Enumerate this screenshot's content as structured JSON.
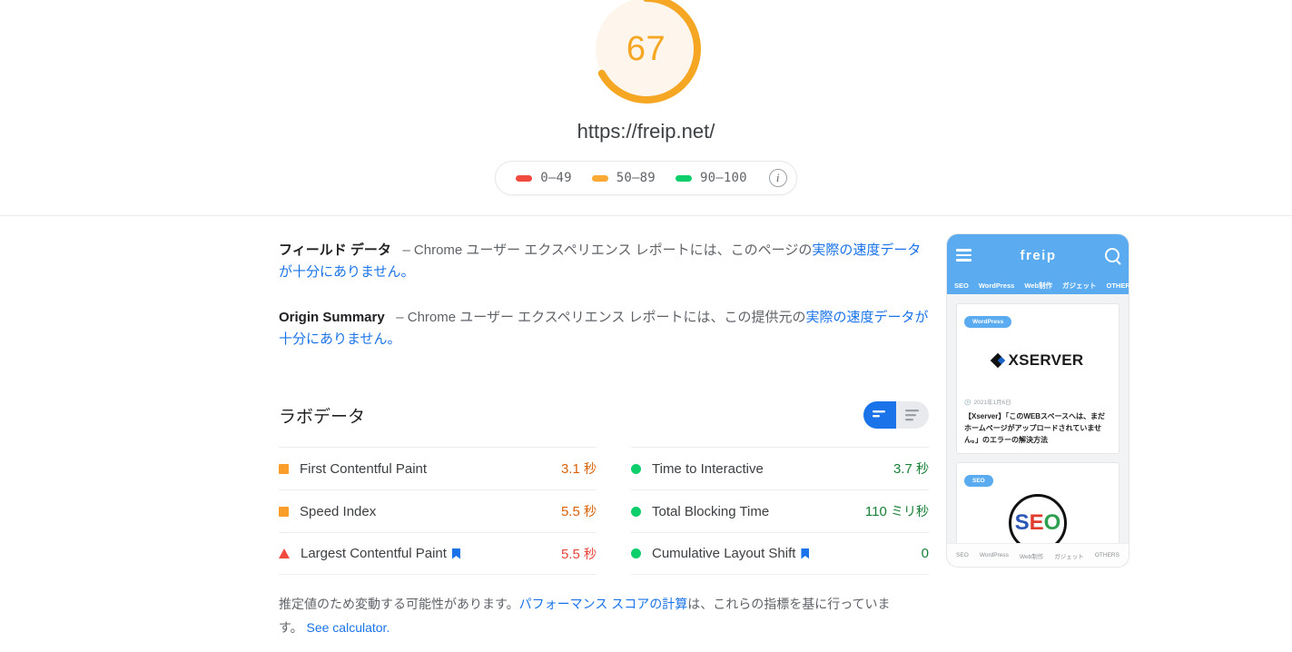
{
  "score": {
    "value": "67",
    "value_number": 67,
    "url": "https://freip.net/",
    "gauge_color": "#f5a623",
    "gauge_track_color": "#fef5e7"
  },
  "legend": {
    "items": [
      {
        "label": "0–49",
        "color": "#f04b3e",
        "name": "legend-range-poor"
      },
      {
        "label": "50–89",
        "color": "#faa935",
        "name": "legend-range-average"
      },
      {
        "label": "90–100",
        "color": "#0cce6b",
        "name": "legend-range-good"
      }
    ],
    "info_glyph": "i"
  },
  "field_data": {
    "title": "フィールド データ",
    "dash": "–",
    "text_before_link": "Chrome ユーザー エクスペリエンス レポートには、このページの",
    "link_text": "実際の速度データが十分にありません。"
  },
  "origin_summary": {
    "title": "Origin Summary",
    "dash": "–",
    "text_before_link": "Chrome ユーザー エクスペリエンス レポートには、この提供元の",
    "link_text": "実際の速度データが十分にありません。"
  },
  "lab_data": {
    "title": "ラボデータ",
    "view_toggle": {
      "active": "list-compact-view",
      "buttons": [
        {
          "name": "toggle-compact-view",
          "state": "active"
        },
        {
          "name": "toggle-detail-view",
          "state": "inactive"
        }
      ]
    },
    "metrics_left": [
      {
        "label": "First Contentful Paint",
        "value": "3.1",
        "unit": "秒",
        "status": "average",
        "icon": "square",
        "value_color_class": "v-orange",
        "bookmark": false
      },
      {
        "label": "Speed Index",
        "value": "5.5",
        "unit": "秒",
        "status": "average",
        "icon": "square",
        "value_color_class": "v-orange",
        "bookmark": false
      },
      {
        "label": "Largest Contentful Paint",
        "value": "5.5",
        "unit": "秒",
        "status": "poor",
        "icon": "triangle",
        "value_color_class": "v-red",
        "bookmark": true
      }
    ],
    "metrics_right": [
      {
        "label": "Time to Interactive",
        "value": "3.7",
        "unit": "秒",
        "status": "good",
        "icon": "circle",
        "value_color_class": "v-green",
        "bookmark": false
      },
      {
        "label": "Total Blocking Time",
        "value": "110",
        "unit": "ミリ秒",
        "status": "good",
        "icon": "circle",
        "value_color_class": "v-green",
        "bookmark": false
      },
      {
        "label": "Cumulative Layout Shift",
        "value": "0",
        "unit": "",
        "status": "good",
        "icon": "circle",
        "value_color_class": "v-green",
        "bookmark": true
      }
    ],
    "footnote": {
      "part1": "推定値のため変動する可能性があります。",
      "link1": "パフォーマンス スコアの計算",
      "part2": "は、これらの指標を基に行っています。",
      "link2": "See calculator."
    }
  },
  "screenshot": {
    "brand": "freip",
    "nav_items": [
      "SEO",
      "WordPress",
      "Web制作",
      "ガジェット",
      "OTHERS"
    ],
    "card1": {
      "tag": "WordPress",
      "logo_text": "XSERVER",
      "date": "2021年1月6日",
      "title": "【Xserver】「このWEBスペースへは、まだホームページがアップロードされていません。」のエラーの解決方法"
    },
    "card2": {
      "tag": "SEO",
      "logo_letters": [
        "S",
        "E",
        "O"
      ]
    },
    "bottom_nav": [
      "SEO",
      "WordPress",
      "Web制作",
      "ガジェット",
      "OTHERS"
    ]
  }
}
